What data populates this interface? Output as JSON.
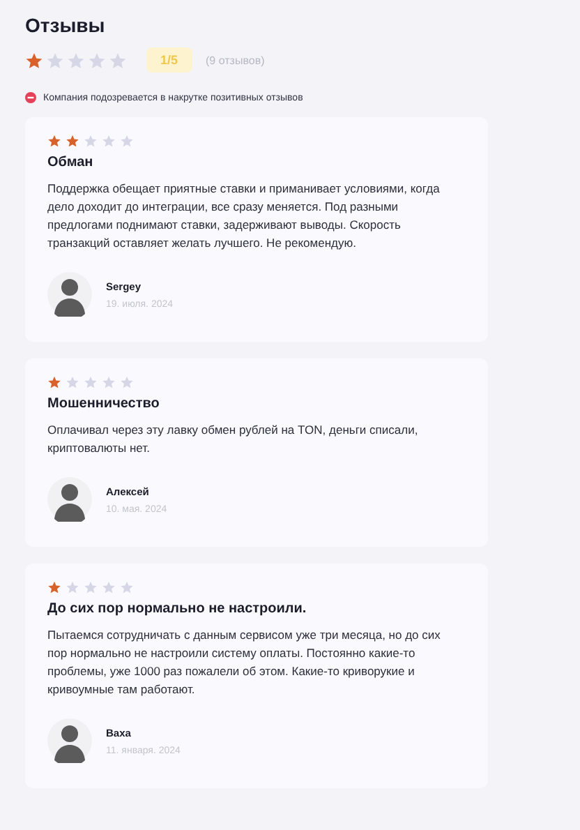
{
  "header": {
    "title": "Отзывы",
    "stars": 1,
    "score": "1/5",
    "count": "(9 отзывов)",
    "warning": "Компания подозревается в накрутке позитивных отзывов"
  },
  "reviews": [
    {
      "stars": 2,
      "title": "Обман",
      "text": "Поддержка обещает приятные ставки и приманивает условиями, когда дело доходит до интеграции, все сразу меняется. Под разными предлогами поднимают ставки, задерживают выводы. Скорость транзакций оставляет желать лучшего. Не рекомендую.",
      "author": "Sergey",
      "date": "19. июля. 2024"
    },
    {
      "stars": 1,
      "title": "Мошенничество",
      "text": "Оплачивал через эту лавку обмен рублей на TON, деньги списали, криптовалюты нет.",
      "author": "Алексей",
      "date": "10. мая. 2024"
    },
    {
      "stars": 1,
      "title": "До сих пор нормально не настроили.",
      "text": "Пытаемся сотрудничать с данным сервисом уже три месяца, но до сих пор нормально не настроили систему оплаты. Постоянно какие-то проблемы, уже 1000 раз пожалели об этом. Какие-то криворукие и кривоумные там работают.",
      "author": "Ваха",
      "date": "11. января. 2024"
    }
  ]
}
